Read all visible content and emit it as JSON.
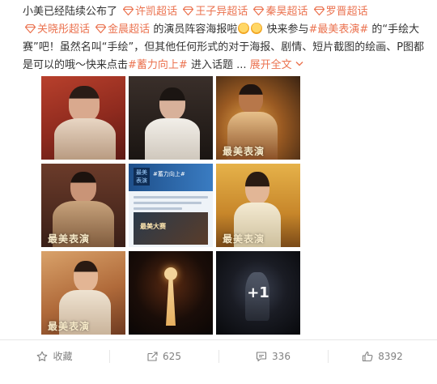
{
  "post": {
    "intro": "小美已经陆续公布了",
    "topics": [
      "许凯超话",
      "王子异超话",
      "秦昊超话",
      "罗晋超话",
      "关晓彤超话",
      "金晨超话"
    ],
    "mid1": "的演员阵容海报啦",
    "mid2": "快来参与",
    "hashtag_contest": "#最美表演#",
    "mid3": "的“手绘大赛”吧！虽然名叫“手绘”，但其他任何形式的对于海报、剧情、短片截图的绘画、P图都是可以的哦～快来点击",
    "hashtag_rise": "#蓄力向上#",
    "mid4": "进入话题 ...",
    "expand_label": "展开全文"
  },
  "images": {
    "poster_caption": "最美表演",
    "screenshot_title": "#蓄力向上#",
    "screenshot_logo": "最美表演",
    "screenshot_banner": "最美大赛",
    "more_count": "+1"
  },
  "actions": {
    "favorite_label": "收藏",
    "repost_count": "625",
    "comment_count": "336",
    "like_count": "8392"
  },
  "colors": {
    "accent": "#eb7350",
    "text": "#333333",
    "muted": "#808080"
  }
}
